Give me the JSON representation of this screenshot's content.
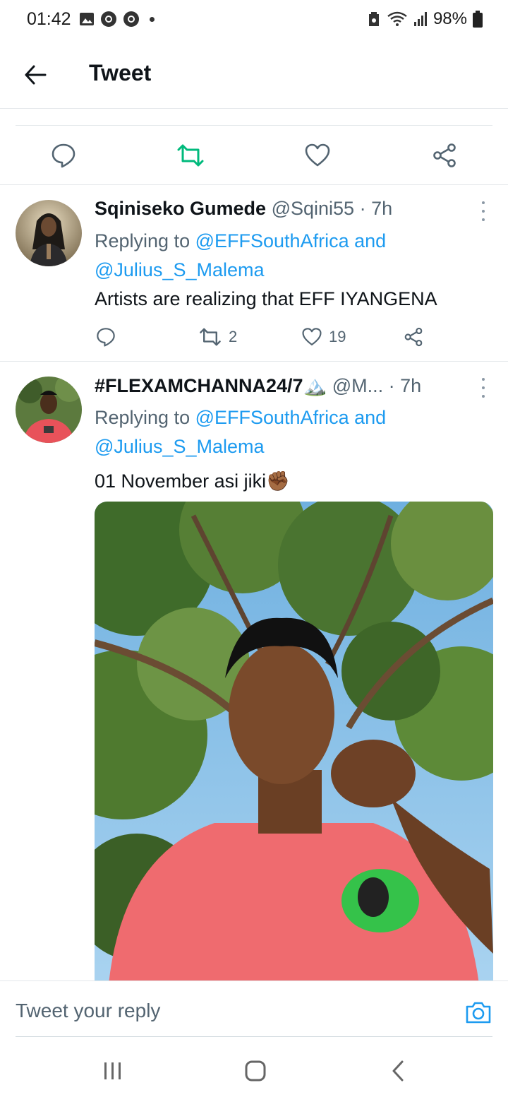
{
  "status_bar": {
    "time": "01:42",
    "battery": "98%"
  },
  "header": {
    "title": "Tweet",
    "back_icon": "arrow-left-icon"
  },
  "main_actions": [
    {
      "icon": "reply-icon"
    },
    {
      "icon": "retweet-icon",
      "color": "#00ba7c"
    },
    {
      "icon": "like-icon"
    },
    {
      "icon": "share-icon"
    }
  ],
  "replies": [
    {
      "name": "Sqiniseko Gumede",
      "handle": "@Sqini55",
      "time": "· 7h",
      "replying_prefix": "Replying to",
      "replying_to_1": "@EFFSouthAfrica",
      "replying_and": "and",
      "replying_to_2": "@Julius_S_Malema",
      "text": "Artists are realizing that EFF IYANGENA",
      "retweets": "2",
      "likes": "19"
    },
    {
      "name": "#FLEXAMCHANNA24/7🏔️",
      "handle": "@M...",
      "time": "· 7h",
      "replying_prefix": "Replying to",
      "replying_to_1": "@EFFSouthAfrica",
      "replying_and": "and",
      "replying_to_2": "@Julius_S_Malema",
      "text": "01 November asi jiki✊🏾"
    }
  ],
  "composer": {
    "placeholder": "Tweet your reply",
    "camera_icon": "camera-icon"
  },
  "colors": {
    "link": "#1d9bf0",
    "secondary_text": "#536471",
    "retweet_green": "#00ba7c"
  }
}
